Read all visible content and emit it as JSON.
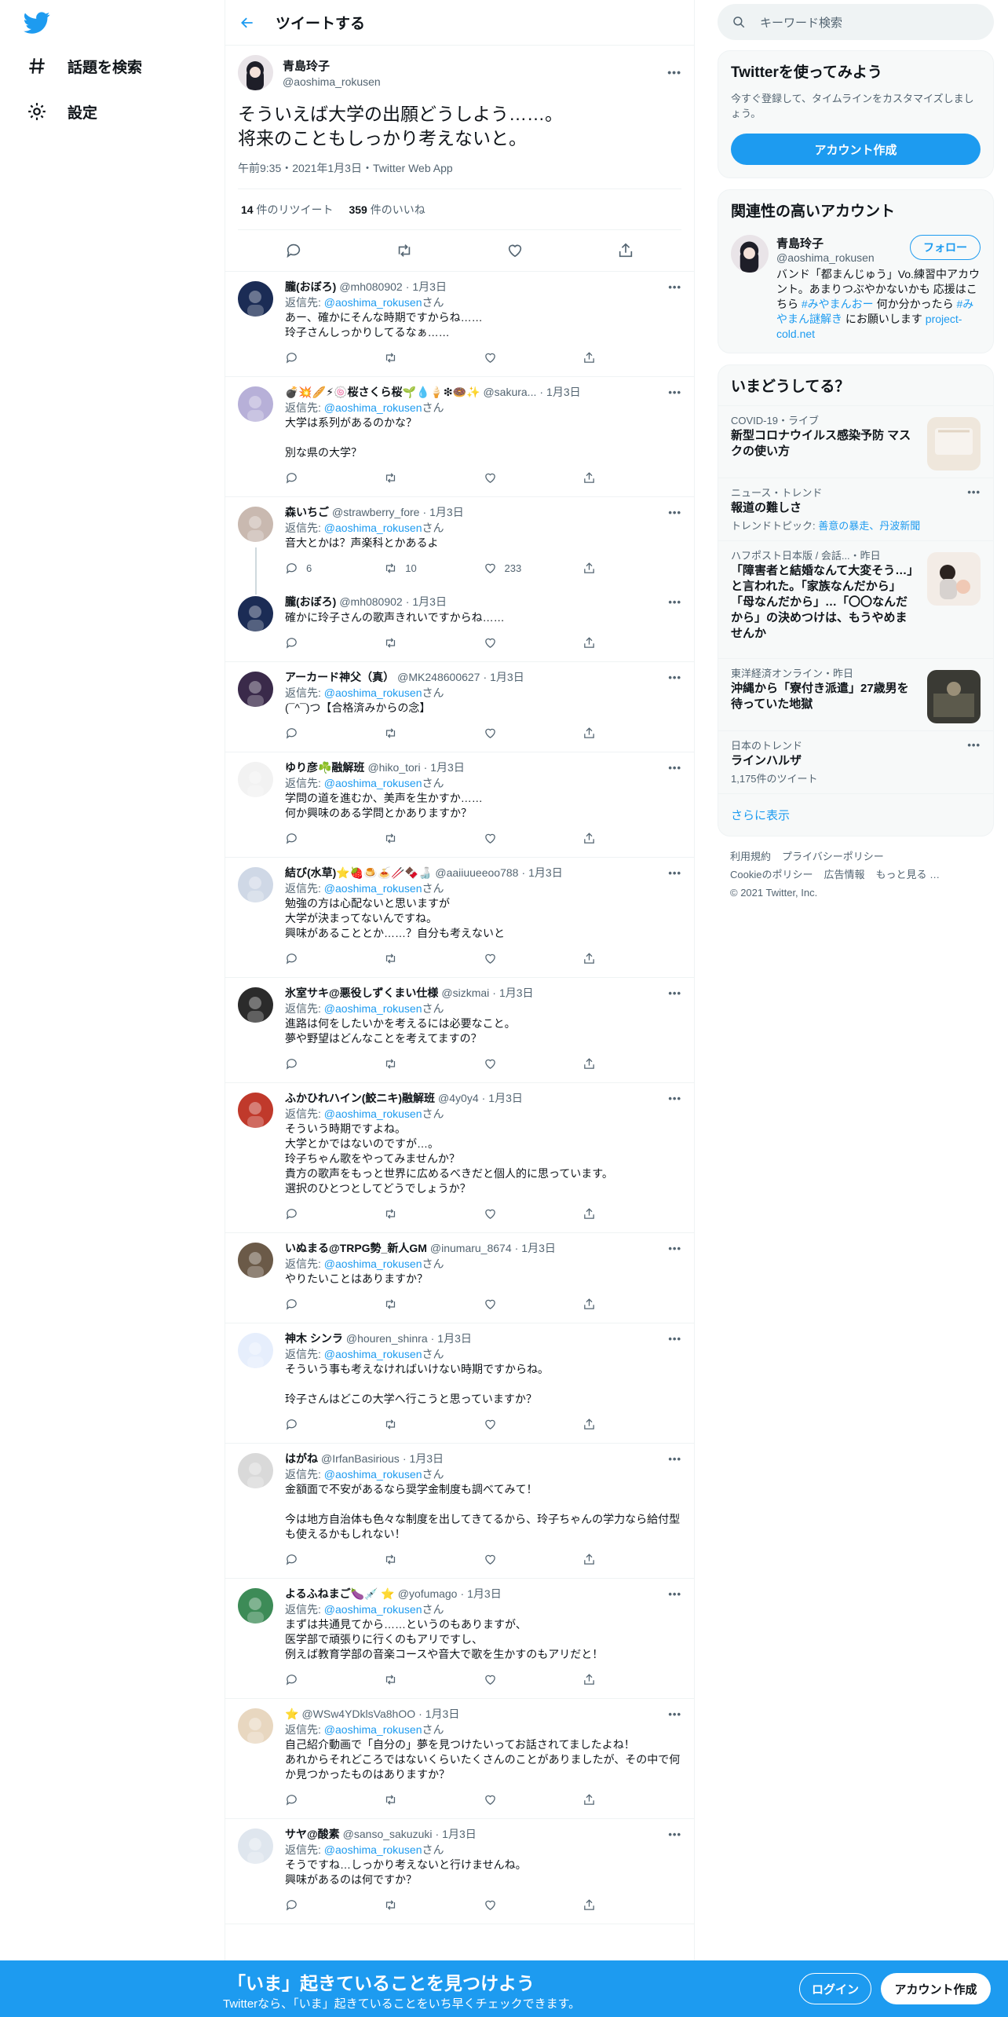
{
  "nav": {
    "explore_label": "話題を検索",
    "settings_label": "設定"
  },
  "header": {
    "title": "ツイートする"
  },
  "focus": {
    "name": "青島玲子",
    "handle": "@aoshima_rokusen",
    "text": "そういえば大学の出願どうしよう……。\n将来のこともしっかり考えないと。",
    "meta": "午前9:35・2021年1月3日・Twitter Web App",
    "retweets_count": "14",
    "retweets_label": "件のリツイート",
    "likes_count": "359",
    "likes_label": "件のいいね"
  },
  "replies": [
    {
      "name": "朧(おぼろ)",
      "handle": "@mh080902",
      "date": "1月3日",
      "reply_to": "@aoshima_rokusen",
      "text": "あー、確かにそんな時期ですからね……\n玲子さんしっかりしてるなぁ……",
      "avatar_color": "#1b2c55"
    },
    {
      "name": "💣💥🥖⚡🍥桜さくら桜🌱💧🍦❇🍩✨",
      "handle": "@sakura...",
      "date": "1月3日",
      "reply_to": "@aoshima_rokusen",
      "text": "大学は系列があるのかな？\n\n別な県の大学？",
      "avatar_color": "#b7b0d8"
    },
    {
      "name": "森いちご",
      "handle": "@strawberry_fore",
      "date": "1月3日",
      "reply_to": "@aoshima_rokusen",
      "text": "音大とかは？声楽科とかあるよ",
      "reply_count": "6",
      "retweet_count": "10",
      "like_count": "233",
      "avatar_color": "#c9b9b0"
    },
    {
      "name": "朧(おぼろ)",
      "handle": "@mh080902",
      "date": "1月3日",
      "reply_to": "",
      "text": "確かに玲子さんの歌声きれいですからね……",
      "avatar_color": "#1b2c55"
    },
    {
      "name": "アーカード神父（真）",
      "handle": "@MK248600627",
      "date": "1月3日",
      "reply_to": "@aoshima_rokusen",
      "text": "(¯^¯)つ【合格済みからの念】",
      "avatar_color": "#3a2a4a"
    },
    {
      "name": "ゆり彦☘️融解班",
      "handle": "@hiko_tori",
      "date": "1月3日",
      "reply_to": "@aoshima_rokusen",
      "text": "学問の道を進むか、美声を生かすか……\n何か興味のある学問とかありますか？",
      "avatar_color": "#f2f2f2"
    },
    {
      "name": "結び(水草)⭐🍓🍮🍝🥢🍫🍶",
      "handle": "@aaiiuueeoo788",
      "date": "1月3日",
      "reply_to": "@aoshima_rokusen",
      "text": "勉強の方は心配ないと思いますが\n大学が決まってないんですね。\n興味があることとか……？自分も考えないと",
      "avatar_color": "#cfd8e6"
    },
    {
      "name": "氷室サキ@悪役しずくまい仕様",
      "handle": "@sizkmai",
      "date": "1月3日",
      "reply_to": "@aoshima_rokusen",
      "text": "進路は何をしたいかを考えるには必要なこと。\n夢や野望はどんなことを考えてますの？",
      "avatar_color": "#2b2b2b"
    },
    {
      "name": "ふかひれハイン(鮫ニキ)融解班",
      "handle": "@4y0y4",
      "date": "1月3日",
      "reply_to": "@aoshima_rokusen",
      "text": "そういう時期ですよね。\n大学とかではないのですが…。\n玲子ちゃん歌をやってみませんか？\n貴方の歌声をもっと世界に広めるべきだと個人的に思っています。\n選択のひとつとしてどうでしょうか？",
      "avatar_color": "#c0392b"
    },
    {
      "name": "いぬまる@TRPG勢_新人GM",
      "handle": "@inumaru_8674",
      "date": "1月3日",
      "reply_to": "@aoshima_rokusen",
      "text": "やりたいことはありますか？",
      "avatar_color": "#6b5a48"
    },
    {
      "name": "神木 シンラ",
      "handle": "@houren_shinra",
      "date": "1月3日",
      "reply_to": "@aoshima_rokusen",
      "text": "そういう事も考えなければいけない時期ですからね。\n\n玲子さんはどこの大学へ行こうと思っていますか？",
      "avatar_color": "#e6eefc"
    },
    {
      "name": "はがね",
      "handle": "@IrfanBasirious",
      "date": "1月3日",
      "reply_to": "@aoshima_rokusen",
      "text": "金額面で不安があるなら奨学金制度も調べてみて！\n\n今は地方自治体も色々な制度を出してきてるから、玲子ちゃんの学力なら給付型も使えるかもしれない！",
      "avatar_color": "#d9d9d9"
    },
    {
      "name": "よるふねまご🍆💉 ⭐",
      "handle": "@yofumago",
      "date": "1月3日",
      "reply_to": "@aoshima_rokusen",
      "text": "まずは共通見てから……というのもありますが、\n医学部で頑張りに行くのもアリですし、\n例えば教育学部の音楽コースや音大で歌を生かすのもアリだと！",
      "avatar_color": "#3d8b57"
    },
    {
      "name": "⭐",
      "handle": "@WSw4YDklsVa8hOO",
      "date": "1月3日",
      "reply_to": "@aoshima_rokusen",
      "text": "自己紹介動画で「自分の」夢を見つけたいってお話されてましたよね！\nあれからそれどころではないくらいたくさんのことがありましたが、その中で何か見つかったものはありますか？",
      "avatar_color": "#e8d7c0"
    },
    {
      "name": "サヤ@酸素",
      "handle": "@sanso_sakuzuki",
      "date": "1月3日",
      "reply_to": "@aoshima_rokusen",
      "text": "そうですね…しっかり考えないと行けませんね。\n興味があるのは何ですか？",
      "avatar_color": "#dfe6ee"
    }
  ],
  "reply_prefix": "返信先:",
  "reply_suffix": "さん",
  "right": {
    "search_placeholder": "キーワード検索",
    "signup_title": "Twitterを使ってみよう",
    "signup_desc": "今すぐ登録して、タイムラインをカスタマイズしましょう。",
    "signup_button": "アカウント作成",
    "related_title": "関連性の高いアカウント",
    "related_name": "青島玲子",
    "related_handle": "@aoshima_rokusen",
    "follow_button": "フォロー",
    "related_bio_1": "バンド「都まんじゅう」Vo.練習中アカウント。あまりつぶやかないかも 応援はこちら ",
    "related_bio_tag1": "#みやまんおー",
    "related_bio_2": " 何か分かったら ",
    "related_bio_tag2": "#みやまん謎解き",
    "related_bio_3": " にお願いします ",
    "related_bio_link": "project-cold.net",
    "trends_title": "いまどうしてる？",
    "trends": [
      {
        "meta": "COVID-19・ライブ",
        "title": "新型コロナウイルス感染予防 マスクの使い方",
        "sub": ""
      },
      {
        "meta": "ニュース・トレンド",
        "title": "報道の難しさ",
        "sub_label": "トレンドトピック: ",
        "sub_topics": "善意の暴走、丹波新聞"
      },
      {
        "meta": "ハフポスト日本版 / 会話...・昨日",
        "title": "「障害者と結婚なんて大変そう…」と言われた。「家族なんだから」「母なんだから」…「〇〇なんだから」の決めつけは、もうやめませんか",
        "sub": ""
      },
      {
        "meta": "東洋経済オンライン・昨日",
        "title": "沖縄から「寮付き派遣」27歳男を待っていた地獄",
        "sub": ""
      },
      {
        "meta": "日本のトレンド",
        "title": "ラインハルザ",
        "sub": "1,175件のツイート"
      }
    ],
    "show_more": "さらに表示",
    "footer": [
      "利用規約",
      "プライバシーポリシー",
      "Cookieのポリシー",
      "広告情報",
      "もっと見る …",
      "© 2021 Twitter, Inc."
    ]
  },
  "banner": {
    "title": "「いま」起きていることを見つけよう",
    "subtitle": "Twitterなら、「いま」起きていることをいち早くチェックできます。",
    "login": "ログイン",
    "signup": "アカウント作成"
  }
}
